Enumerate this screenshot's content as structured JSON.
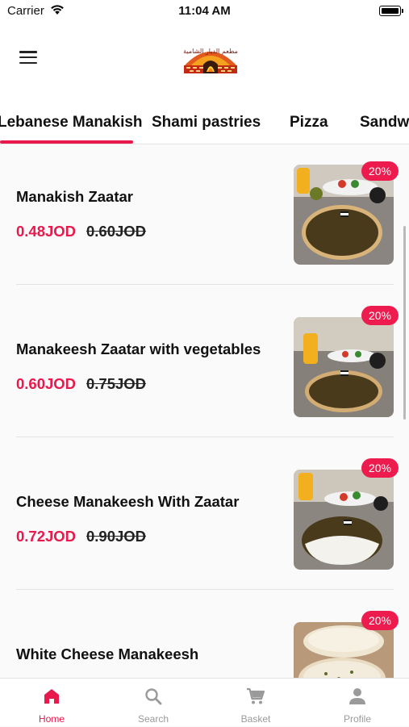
{
  "status_bar": {
    "carrier": "Carrier",
    "time": "11:04 AM"
  },
  "header": {
    "logo_text": "مطعم الديار الشامية"
  },
  "tabs": [
    {
      "label": "Lebanese Manakish",
      "active": true
    },
    {
      "label": "Shami pastries",
      "active": false
    },
    {
      "label": "Pizza",
      "active": false
    },
    {
      "label": "Sandwi",
      "active": false
    }
  ],
  "items": [
    {
      "name": "Manakish Zaatar",
      "price": "0.48JOD",
      "old_price": "0.60JOD",
      "discount": "20%"
    },
    {
      "name": "Manakeesh Zaatar with vegetables",
      "price": "0.60JOD",
      "old_price": "0.75JOD",
      "discount": "20%"
    },
    {
      "name": "Cheese Manakeesh With Zaatar",
      "price": "0.72JOD",
      "old_price": "0.90JOD",
      "discount": "20%"
    },
    {
      "name": "White Cheese Manakeesh",
      "price": "",
      "old_price": "",
      "discount": "20%"
    }
  ],
  "bottom_nav": [
    {
      "label": "Home",
      "icon": "home-icon",
      "active": true
    },
    {
      "label": "Search",
      "icon": "search-icon",
      "active": false
    },
    {
      "label": "Basket",
      "icon": "cart-icon",
      "active": false
    },
    {
      "label": "Profile",
      "icon": "person-icon",
      "active": false
    }
  ],
  "colors": {
    "accent": "#e8194c",
    "badge": "#ee1c4e",
    "inactive": "#9a9a9a"
  }
}
